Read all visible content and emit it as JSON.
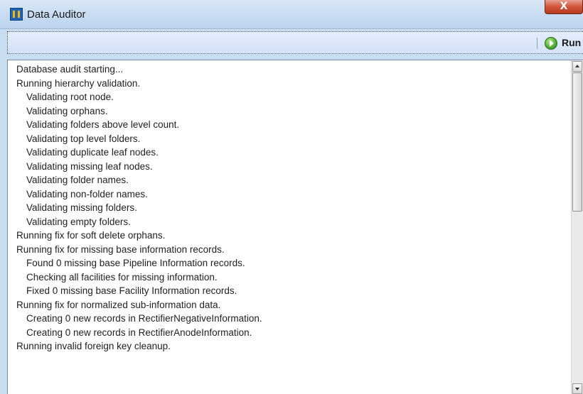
{
  "window": {
    "title": "Data Auditor",
    "close_label": "X"
  },
  "toolbar": {
    "run_label": "Run",
    "run_icon": "play-circle-icon"
  },
  "log": {
    "lines": [
      {
        "text": "Database audit starting...",
        "indent": false
      },
      {
        "text": "Running hierarchy validation.",
        "indent": false
      },
      {
        "text": "Validating root node.",
        "indent": true
      },
      {
        "text": "Validating orphans.",
        "indent": true
      },
      {
        "text": "Validating folders above level count.",
        "indent": true
      },
      {
        "text": "Validating top level folders.",
        "indent": true
      },
      {
        "text": "Validating duplicate leaf nodes.",
        "indent": true
      },
      {
        "text": "Validating missing leaf nodes.",
        "indent": true
      },
      {
        "text": "Validating folder names.",
        "indent": true
      },
      {
        "text": "Validating non-folder names.",
        "indent": true
      },
      {
        "text": "Validating missing folders.",
        "indent": true
      },
      {
        "text": "Validating empty folders.",
        "indent": true
      },
      {
        "text": "Running fix for soft delete orphans.",
        "indent": false
      },
      {
        "text": "Running fix for missing base information records.",
        "indent": false
      },
      {
        "text": "Found 0 missing base Pipeline Information records.",
        "indent": true
      },
      {
        "text": "Checking all facilities for missing information.",
        "indent": true
      },
      {
        "text": "Fixed 0 missing base Facility Information records.",
        "indent": true
      },
      {
        "text": "Running fix for normalized sub-information data.",
        "indent": false
      },
      {
        "text": "Creating 0 new records in RectifierNegativeInformation.",
        "indent": true
      },
      {
        "text": "Creating 0 new records in RectifierAnodeInformation.",
        "indent": true
      },
      {
        "text": "Running invalid foreign key cleanup.",
        "indent": false
      }
    ]
  },
  "colors": {
    "titlebar": "#c7dbf1",
    "close_button": "#d0563c",
    "run_icon": "#4fb23a"
  }
}
